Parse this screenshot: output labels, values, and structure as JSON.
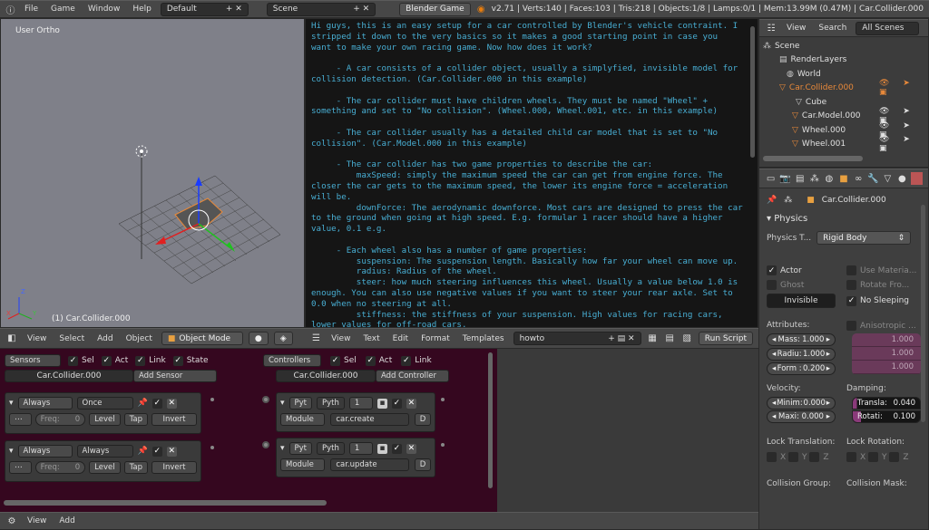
{
  "topbar": {
    "menus": [
      "File",
      "Game",
      "Window",
      "Help"
    ],
    "layout": "Default",
    "scene": "Scene",
    "engine": "Blender Game",
    "stats": "v2.71 | Verts:140 | Faces:103 | Tris:218 | Objects:1/8 | Lamps:0/1 | Mem:13.99M (0.47M) | Car.Collider.000"
  },
  "viewport": {
    "view_label": "User Ortho",
    "object_label": "(1) Car.Collider.000",
    "axis_x": "X",
    "axis_y": "Y",
    "axis_z": "Z"
  },
  "view3d_header": {
    "menus": [
      "View",
      "Select",
      "Add",
      "Object"
    ],
    "mode": "Object Mode"
  },
  "text_header": {
    "menus": [
      "View",
      "Text",
      "Edit",
      "Format",
      "Templates"
    ],
    "text_name": "howto",
    "run_script": "Run Script"
  },
  "text_lines": [
    "Hi guys, this is an easy setup for a car controlled by Blender's vehicle contraint. I",
    "stripped it down to the very basics so it makes a good starting point in case you",
    "want to make your own racing game. Now how does it work?",
    "",
    "     - A car consists of a collider object, usually a simplyfied, invisible model for",
    "collision detection. (Car.Collider.000 in this example)",
    "",
    "     - The car collider must have children wheels. They must be named \"Wheel\" +",
    "something and set to \"No collision\". (Wheel.000, Wheel.001, etc. in this example)",
    "",
    "     - The car collider usually has a detailed child car model that is set to \"No",
    "collision\". (Car.Model.000 in this example)",
    "",
    "     - The car collider has two game properties to describe the car:",
    "         maxSpeed: simply the maximum speed the car can get from engine force. The",
    "closer the car gets to the maximum speed, the lower its engine force = acceleration",
    "will be.",
    "         downForce: The aerodynamic downforce. Most cars are designed to press the car",
    "to the ground when going at high speed. E.g. formular 1 racer should have a higher",
    "value, 0.1 e.g.",
    "",
    "     - Each wheel also has a number of game properties:",
    "         suspension: The suspension length. Basically how far your wheel can move up.",
    "         radius: Radius of the wheel.",
    "         steer: how much steering influences this wheel. Usually a value below 1.0 is",
    "enough. You can also use negative values if you want to steer your rear axle. Set to",
    "0.0 when no steering at all.",
    "         stiffness: the stiffness of your suspension. High values for racing cars,",
    "lower values for off-road cars."
  ],
  "outliner": {
    "menus": [
      "View",
      "Search"
    ],
    "filter": "All Scenes",
    "items": [
      "Scene",
      "RenderLayers",
      "World",
      "Car.Collider.000",
      "Cube",
      "Car.Model.000",
      "Wheel.000",
      "Wheel.001"
    ]
  },
  "properties": {
    "object": "Car.Collider.000",
    "panel": "Physics",
    "physics_type_label": "Physics T...",
    "physics_type": "Rigid Body",
    "actor": "Actor",
    "ghost": "Ghost",
    "invisible": "Invisible",
    "use_material": "Use Materia...",
    "rotate_from": "Rotate Fro...",
    "no_sleeping": "No Sleeping",
    "attributes": "Attributes:",
    "anisotropic": "Anisotropic ...",
    "mass": "Mass:",
    "mass_v": "1.000",
    "radius": "Radiu:",
    "radius_v": "1.000",
    "form": "Form :",
    "form_v": "0.200",
    "aniso_values": [
      "1.000",
      "1.000",
      "1.000"
    ],
    "velocity": "Velocity:",
    "min": "Minim:",
    "min_v": "0.000",
    "max": "Maxi:",
    "max_v": "0.000",
    "damping": "Damping:",
    "trans": "Transla:",
    "trans_v": "0.040",
    "rot": "Rotati:",
    "rot_v": "0.100",
    "lock_translation": "Lock Translation:",
    "lock_rotation": "Lock Rotation:",
    "axes": [
      "X",
      "Y",
      "Z"
    ],
    "collision_group": "Collision Group:",
    "collision_mask": "Collision Mask:"
  },
  "logic": {
    "sensors": {
      "menu": "Sensors",
      "filters": [
        "Sel",
        "Act",
        "Link",
        "State"
      ],
      "object": "Car.Collider.000",
      "add": "Add Sensor",
      "bricks": [
        {
          "type": "Always",
          "name": "Once",
          "freq_label": "Freq:",
          "freq": "0",
          "level": "Level",
          "tap": "Tap",
          "invert": "Invert"
        },
        {
          "type": "Always",
          "name": "Always",
          "freq_label": "Freq:",
          "freq": "0",
          "level": "Level",
          "tap": "Tap",
          "invert": "Invert"
        }
      ]
    },
    "controllers": {
      "menu": "Controllers",
      "filters": [
        "Sel",
        "Act",
        "Link"
      ],
      "object": "Car.Collider.000",
      "add": "Add Controller",
      "bricks": [
        {
          "type": "Pyt",
          "name": "Pyth",
          "state": "1",
          "mode": "Module",
          "module": "car.create",
          "debug": "D"
        },
        {
          "type": "Pyt",
          "name": "Pyth",
          "state": "1",
          "mode": "Module",
          "module": "car.update",
          "debug": "D"
        }
      ]
    }
  },
  "bottom_header": {
    "menus": [
      "View",
      "Add"
    ]
  }
}
